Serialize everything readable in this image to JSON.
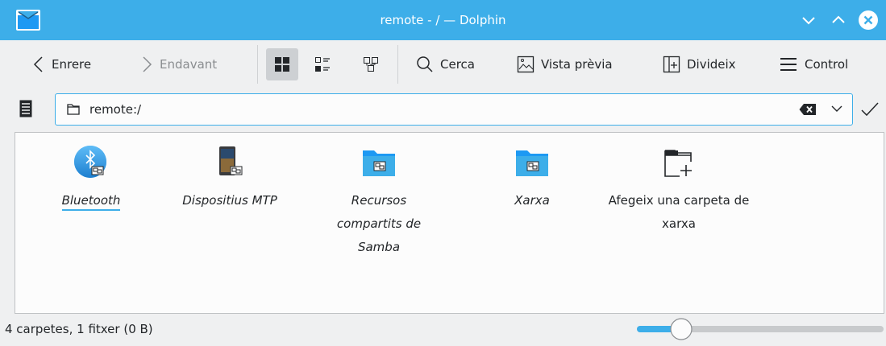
{
  "window": {
    "title": "remote - / — Dolphin",
    "accent_color": "#3daee9"
  },
  "toolbar": {
    "back_label": "Enrere",
    "forward_label": "Endavant",
    "search_label": "Cerca",
    "preview_label": "Vista prèvia",
    "split_label": "Divideix",
    "control_label": "Control",
    "view_mode_selected": "icons"
  },
  "location": {
    "path": "remote:/"
  },
  "items": [
    {
      "label": "Bluetooth",
      "icon": "bluetooth-icon",
      "selected": true
    },
    {
      "label": "Dispositius MTP",
      "icon": "mtp-device-icon",
      "selected": false
    },
    {
      "label": "Recursos compartits de Samba",
      "icon": "samba-folder-icon",
      "selected": false
    },
    {
      "label": "Xarxa",
      "icon": "network-folder-icon",
      "selected": false
    },
    {
      "label": "Afegeix una carpeta de xarxa",
      "icon": "add-network-folder-icon",
      "selected": false
    }
  ],
  "statusbar": {
    "text": "4 carpetes, 1 fitxer (0 B)",
    "zoom_fraction": 0.15
  }
}
